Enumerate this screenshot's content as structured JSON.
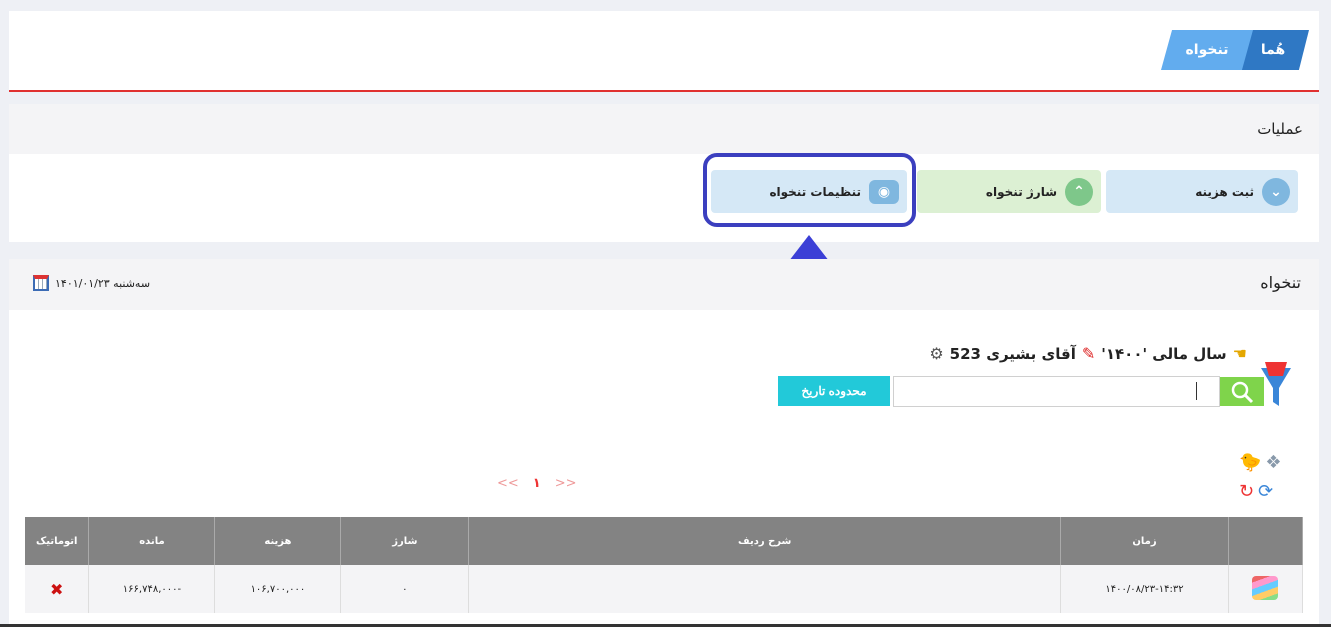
{
  "breadcrumb": {
    "home": "هُما",
    "current": "تنخواه"
  },
  "operations": {
    "title": "عملیات",
    "buttons": {
      "expense": "ثبت هزینه",
      "charge": "شارژ تنخواه",
      "settings": "تنظیمات تنخواه"
    }
  },
  "section": {
    "title": "تنخواه",
    "date": "سه‌شنبه ۱۴۰۱/۰۱/۲۳"
  },
  "info": {
    "fiscal_year": "سال مالی '۱۴۰۰'",
    "person": "آقای بشیری 523"
  },
  "search": {
    "value": "",
    "range_button": "محدوده تاریخ"
  },
  "pager": {
    "prev": "<<",
    "current": "۱",
    "next": ">>"
  },
  "table": {
    "headers": [
      "",
      "زمان",
      "شرح ردیف",
      "شارژ",
      "هزینه",
      "مانده",
      "اتوماتیک"
    ],
    "rows": [
      {
        "time": "۱۴۰۰/۰۸/۲۳-۱۴:۳۲",
        "desc": "",
        "charge": "۰",
        "expense": "۱۰۶,۷۰۰,۰۰۰",
        "balance": "۱۶۶,۷۴۸,۰۰۰-"
      }
    ]
  },
  "colors": {
    "accent": "#2f78c4",
    "highlight": "#3b3fbf",
    "range_button": "#22c9d9",
    "search_button": "#7fd44b"
  },
  "icons": [
    "calendar-icon",
    "hand-pointer-icon",
    "pin-icon",
    "gear-icon",
    "funnel-icon",
    "search-icon",
    "refresh-icon",
    "x-icon"
  ]
}
